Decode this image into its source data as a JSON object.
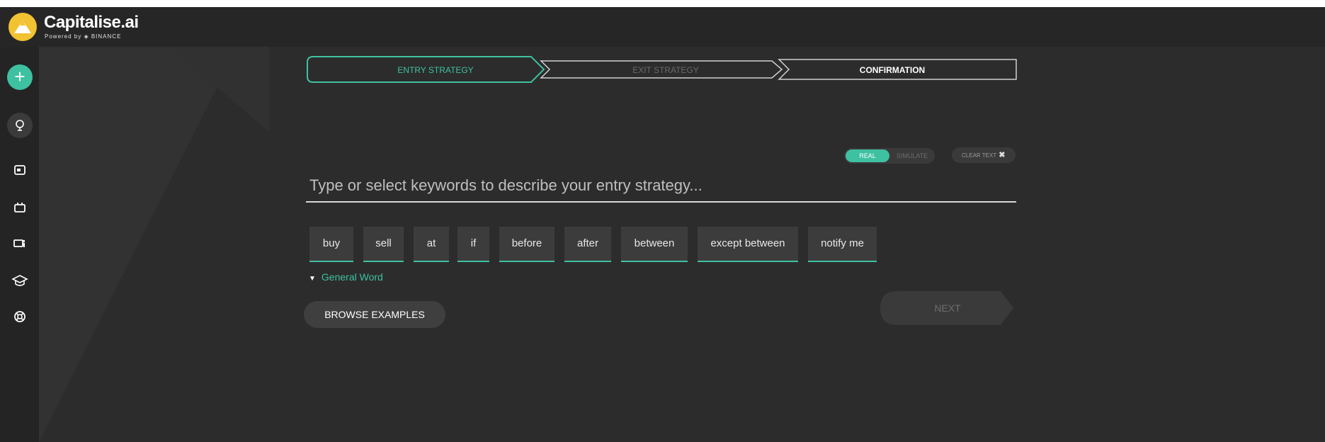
{
  "app": {
    "brand": "Capitalise.ai",
    "powered_by": "Powered by ◈ BINANCE"
  },
  "sidebar": {
    "items": [
      {
        "icon": "plus-icon"
      },
      {
        "icon": "lightbulb-icon"
      },
      {
        "icon": "dashboard-icon"
      },
      {
        "icon": "briefcase-icon"
      },
      {
        "icon": "notification-icon"
      },
      {
        "icon": "graduation-cap-icon"
      },
      {
        "icon": "support-icon"
      }
    ]
  },
  "steps": {
    "entry": "ENTRY STRATEGY",
    "exit": "EXIT STRATEGY",
    "confirmation": "CONFIRMATION",
    "active": "entry"
  },
  "mode_toggle": {
    "real": "REAL",
    "simulate": "SIMULATE",
    "selected": "REAL"
  },
  "clear_text": {
    "label": "CLEAR TEXT",
    "icon": "✖"
  },
  "strategy_input": {
    "value": "",
    "placeholder": "Type or select keywords to describe your entry strategy..."
  },
  "keywords": [
    "buy",
    "sell",
    "at",
    "if",
    "before",
    "after",
    "between",
    "except between",
    "notify me"
  ],
  "general_word": {
    "label": "General Word",
    "icon": "▼"
  },
  "actions": {
    "browse": "BROWSE EXAMPLES",
    "next": "NEXT"
  },
  "colors": {
    "accent": "#3ec1a1",
    "background": "#2c2c2c",
    "logo": "#f1c232"
  }
}
